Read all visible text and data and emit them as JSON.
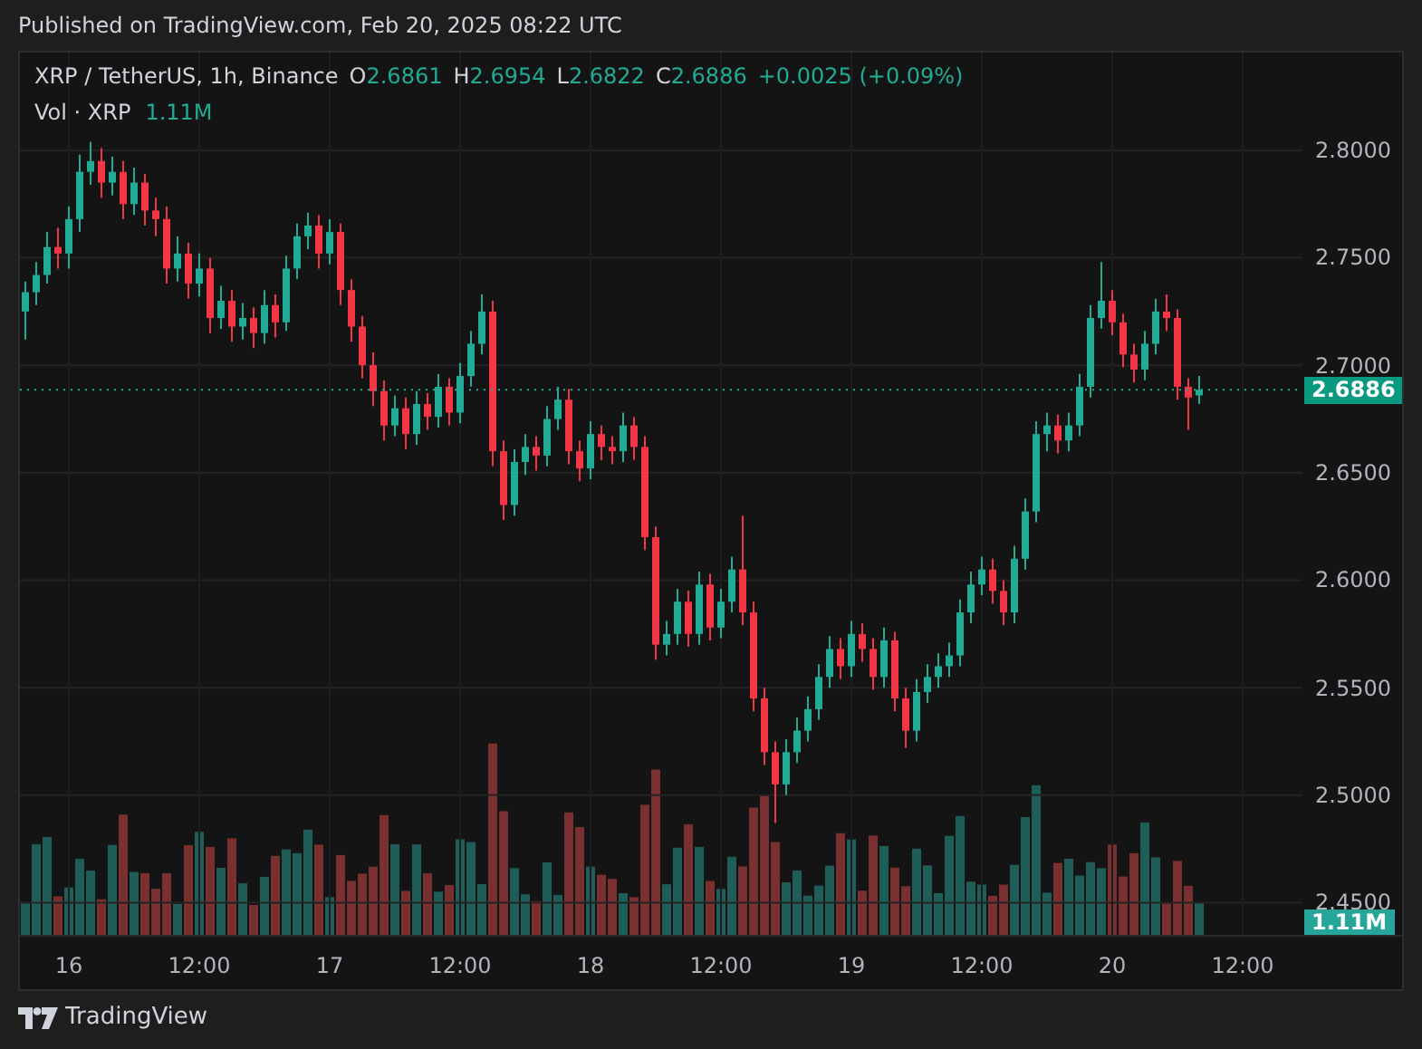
{
  "published": "Published on TradingView.com, Feb 20, 2025 08:22 UTC",
  "legend": {
    "symbol": "XRP / TetherUS, 1h, Binance",
    "ohlc": [
      {
        "label": "O",
        "value": "2.6861"
      },
      {
        "label": "H",
        "value": "2.6954"
      },
      {
        "label": "L",
        "value": "2.6822"
      },
      {
        "label": "C",
        "value": "2.6886"
      }
    ],
    "change": "+0.0025 (+0.09%)",
    "volume_label": "Vol · XRP",
    "volume_value": "1.11M"
  },
  "chart_data": {
    "type": "candlestick",
    "x": [
      "2025-02-15T20:00",
      "2025-02-15T21:00",
      "2025-02-15T22:00",
      "2025-02-15T23:00",
      "2025-02-16T00:00",
      "2025-02-16T01:00",
      "2025-02-16T02:00",
      "2025-02-16T03:00",
      "2025-02-16T04:00",
      "2025-02-16T05:00",
      "2025-02-16T06:00",
      "2025-02-16T07:00",
      "2025-02-16T08:00",
      "2025-02-16T09:00",
      "2025-02-16T10:00",
      "2025-02-16T11:00",
      "2025-02-16T12:00",
      "2025-02-16T13:00",
      "2025-02-16T14:00",
      "2025-02-16T15:00",
      "2025-02-16T16:00",
      "2025-02-16T17:00",
      "2025-02-16T18:00",
      "2025-02-16T19:00",
      "2025-02-16T20:00",
      "2025-02-16T21:00",
      "2025-02-16T22:00",
      "2025-02-16T23:00",
      "2025-02-17T00:00",
      "2025-02-17T01:00",
      "2025-02-17T02:00",
      "2025-02-17T03:00",
      "2025-02-17T04:00",
      "2025-02-17T05:00",
      "2025-02-17T06:00",
      "2025-02-17T07:00",
      "2025-02-17T08:00",
      "2025-02-17T09:00",
      "2025-02-17T10:00",
      "2025-02-17T11:00",
      "2025-02-17T12:00",
      "2025-02-17T13:00",
      "2025-02-17T14:00",
      "2025-02-17T15:00",
      "2025-02-17T16:00",
      "2025-02-17T17:00",
      "2025-02-17T18:00",
      "2025-02-17T19:00",
      "2025-02-17T20:00",
      "2025-02-17T21:00",
      "2025-02-17T22:00",
      "2025-02-17T23:00",
      "2025-02-18T00:00",
      "2025-02-18T01:00",
      "2025-02-18T02:00",
      "2025-02-18T03:00",
      "2025-02-18T04:00",
      "2025-02-18T05:00",
      "2025-02-18T06:00",
      "2025-02-18T07:00",
      "2025-02-18T08:00",
      "2025-02-18T09:00",
      "2025-02-18T10:00",
      "2025-02-18T11:00",
      "2025-02-18T12:00",
      "2025-02-18T13:00",
      "2025-02-18T14:00",
      "2025-02-18T15:00",
      "2025-02-18T16:00",
      "2025-02-18T17:00",
      "2025-02-18T18:00",
      "2025-02-18T19:00",
      "2025-02-18T20:00",
      "2025-02-18T21:00",
      "2025-02-18T22:00",
      "2025-02-18T23:00",
      "2025-02-19T00:00",
      "2025-02-19T01:00",
      "2025-02-19T02:00",
      "2025-02-19T03:00",
      "2025-02-19T04:00",
      "2025-02-19T05:00",
      "2025-02-19T06:00",
      "2025-02-19T07:00",
      "2025-02-19T08:00",
      "2025-02-19T09:00",
      "2025-02-19T10:00",
      "2025-02-19T11:00",
      "2025-02-19T12:00",
      "2025-02-19T13:00",
      "2025-02-19T14:00",
      "2025-02-19T15:00",
      "2025-02-19T16:00",
      "2025-02-19T17:00",
      "2025-02-19T18:00",
      "2025-02-19T19:00",
      "2025-02-19T20:00",
      "2025-02-19T21:00",
      "2025-02-19T22:00",
      "2025-02-19T23:00",
      "2025-02-20T00:00",
      "2025-02-20T01:00",
      "2025-02-20T02:00",
      "2025-02-20T03:00",
      "2025-02-20T04:00",
      "2025-02-20T05:00",
      "2025-02-20T06:00",
      "2025-02-20T07:00",
      "2025-02-20T08:00"
    ],
    "ohlc": [
      [
        2.725,
        2.739,
        2.712,
        2.734
      ],
      [
        2.734,
        2.748,
        2.728,
        2.742
      ],
      [
        2.742,
        2.762,
        2.738,
        2.755
      ],
      [
        2.755,
        2.764,
        2.745,
        2.752
      ],
      [
        2.752,
        2.774,
        2.745,
        2.768
      ],
      [
        2.768,
        2.798,
        2.762,
        2.79
      ],
      [
        2.79,
        2.804,
        2.784,
        2.795
      ],
      [
        2.795,
        2.801,
        2.778,
        2.785
      ],
      [
        2.785,
        2.797,
        2.779,
        2.79
      ],
      [
        2.79,
        2.795,
        2.768,
        2.775
      ],
      [
        2.775,
        2.792,
        2.77,
        2.785
      ],
      [
        2.785,
        2.789,
        2.765,
        2.772
      ],
      [
        2.772,
        2.778,
        2.76,
        2.768
      ],
      [
        2.768,
        2.774,
        2.738,
        2.745
      ],
      [
        2.745,
        2.76,
        2.739,
        2.752
      ],
      [
        2.752,
        2.757,
        2.731,
        2.738
      ],
      [
        2.738,
        2.752,
        2.732,
        2.745
      ],
      [
        2.745,
        2.75,
        2.715,
        2.722
      ],
      [
        2.722,
        2.737,
        2.717,
        2.73
      ],
      [
        2.73,
        2.735,
        2.711,
        2.718
      ],
      [
        2.718,
        2.729,
        2.712,
        2.722
      ],
      [
        2.722,
        2.727,
        2.708,
        2.715
      ],
      [
        2.715,
        2.735,
        2.71,
        2.728
      ],
      [
        2.728,
        2.733,
        2.713,
        2.72
      ],
      [
        2.72,
        2.751,
        2.716,
        2.745
      ],
      [
        2.745,
        2.766,
        2.74,
        2.76
      ],
      [
        2.76,
        2.771,
        2.754,
        2.765
      ],
      [
        2.765,
        2.77,
        2.745,
        2.752
      ],
      [
        2.752,
        2.768,
        2.747,
        2.762
      ],
      [
        2.762,
        2.766,
        2.728,
        2.735
      ],
      [
        2.735,
        2.74,
        2.711,
        2.718
      ],
      [
        2.718,
        2.723,
        2.694,
        2.7
      ],
      [
        2.7,
        2.706,
        2.681,
        2.688
      ],
      [
        2.688,
        2.693,
        2.665,
        2.672
      ],
      [
        2.672,
        2.686,
        2.667,
        2.68
      ],
      [
        2.68,
        2.685,
        2.661,
        2.668
      ],
      [
        2.668,
        2.688,
        2.663,
        2.682
      ],
      [
        2.682,
        2.687,
        2.67,
        2.676
      ],
      [
        2.676,
        2.696,
        2.671,
        2.69
      ],
      [
        2.69,
        2.694,
        2.672,
        2.678
      ],
      [
        2.678,
        2.701,
        2.673,
        2.695
      ],
      [
        2.695,
        2.716,
        2.69,
        2.71
      ],
      [
        2.71,
        2.733,
        2.705,
        2.725
      ],
      [
        2.725,
        2.73,
        2.653,
        2.66
      ],
      [
        2.66,
        2.665,
        2.628,
        2.635
      ],
      [
        2.635,
        2.661,
        2.63,
        2.655
      ],
      [
        2.655,
        2.668,
        2.649,
        2.662
      ],
      [
        2.662,
        2.667,
        2.651,
        2.658
      ],
      [
        2.658,
        2.681,
        2.653,
        2.675
      ],
      [
        2.675,
        2.69,
        2.67,
        2.684
      ],
      [
        2.684,
        2.689,
        2.654,
        2.66
      ],
      [
        2.66,
        2.665,
        2.646,
        2.652
      ],
      [
        2.652,
        2.674,
        2.647,
        2.668
      ],
      [
        2.668,
        2.672,
        2.656,
        2.662
      ],
      [
        2.662,
        2.667,
        2.654,
        2.66
      ],
      [
        2.66,
        2.678,
        2.655,
        2.672
      ],
      [
        2.672,
        2.676,
        2.656,
        2.662
      ],
      [
        2.662,
        2.667,
        2.614,
        2.62
      ],
      [
        2.62,
        2.625,
        2.563,
        2.57
      ],
      [
        2.57,
        2.581,
        2.565,
        2.575
      ],
      [
        2.575,
        2.596,
        2.57,
        2.59
      ],
      [
        2.59,
        2.595,
        2.569,
        2.575
      ],
      [
        2.575,
        2.604,
        2.57,
        2.598
      ],
      [
        2.598,
        2.603,
        2.572,
        2.578
      ],
      [
        2.578,
        2.596,
        2.573,
        2.59
      ],
      [
        2.59,
        2.611,
        2.585,
        2.605
      ],
      [
        2.605,
        2.63,
        2.579,
        2.585
      ],
      [
        2.585,
        2.59,
        2.539,
        2.545
      ],
      [
        2.545,
        2.55,
        2.514,
        2.52
      ],
      [
        2.52,
        2.525,
        2.487,
        2.505
      ],
      [
        2.505,
        2.526,
        2.5,
        2.52
      ],
      [
        2.52,
        2.536,
        2.515,
        2.53
      ],
      [
        2.53,
        2.546,
        2.525,
        2.54
      ],
      [
        2.54,
        2.561,
        2.535,
        2.555
      ],
      [
        2.555,
        2.574,
        2.55,
        2.568
      ],
      [
        2.568,
        2.573,
        2.554,
        2.56
      ],
      [
        2.56,
        2.581,
        2.555,
        2.575
      ],
      [
        2.575,
        2.58,
        2.562,
        2.568
      ],
      [
        2.568,
        2.573,
        2.549,
        2.555
      ],
      [
        2.555,
        2.578,
        2.55,
        2.572
      ],
      [
        2.572,
        2.576,
        2.539,
        2.545
      ],
      [
        2.545,
        2.55,
        2.522,
        2.53
      ],
      [
        2.53,
        2.554,
        2.525,
        2.548
      ],
      [
        2.548,
        2.561,
        2.543,
        2.555
      ],
      [
        2.555,
        2.566,
        2.55,
        2.56
      ],
      [
        2.56,
        2.571,
        2.555,
        2.565
      ],
      [
        2.565,
        2.591,
        2.56,
        2.585
      ],
      [
        2.585,
        2.604,
        2.58,
        2.598
      ],
      [
        2.598,
        2.611,
        2.593,
        2.605
      ],
      [
        2.605,
        2.61,
        2.589,
        2.595
      ],
      [
        2.595,
        2.6,
        2.579,
        2.585
      ],
      [
        2.585,
        2.616,
        2.58,
        2.61
      ],
      [
        2.61,
        2.638,
        2.605,
        2.632
      ],
      [
        2.632,
        2.674,
        2.627,
        2.668
      ],
      [
        2.668,
        2.678,
        2.66,
        2.672
      ],
      [
        2.672,
        2.677,
        2.659,
        2.665
      ],
      [
        2.665,
        2.678,
        2.66,
        2.672
      ],
      [
        2.672,
        2.696,
        2.667,
        2.69
      ],
      [
        2.69,
        2.728,
        2.685,
        2.722
      ],
      [
        2.722,
        2.748,
        2.717,
        2.73
      ],
      [
        2.73,
        2.735,
        2.714,
        2.72
      ],
      [
        2.72,
        2.724,
        2.699,
        2.705
      ],
      [
        2.705,
        2.71,
        2.692,
        2.698
      ],
      [
        2.698,
        2.716,
        2.693,
        2.71
      ],
      [
        2.71,
        2.731,
        2.705,
        2.725
      ],
      [
        2.725,
        2.733,
        2.716,
        2.722
      ],
      [
        2.722,
        2.726,
        2.684,
        2.69
      ],
      [
        2.69,
        2.694,
        2.67,
        2.685
      ],
      [
        2.686,
        2.695,
        2.682,
        2.6886
      ]
    ],
    "xlim": [
      "2025-02-15T19:30",
      "2025-02-21T03:00"
    ],
    "grid": true,
    "ref_lines": [
      {
        "axis": "y",
        "value": 2.6886
      }
    ],
    "ylim": [
      2.435,
      2.8455
    ],
    "xticks": [
      {
        "value": "2025-02-16T00:00",
        "label": "16"
      },
      {
        "value": "2025-02-16T12:00",
        "label": "12:00"
      },
      {
        "value": "2025-02-17T00:00",
        "label": "17"
      },
      {
        "value": "2025-02-17T12:00",
        "label": "12:00"
      },
      {
        "value": "2025-02-18T00:00",
        "label": "18"
      },
      {
        "value": "2025-02-18T12:00",
        "label": "12:00"
      },
      {
        "value": "2025-02-19T00:00",
        "label": "19"
      },
      {
        "value": "2025-02-19T12:00",
        "label": "12:00"
      },
      {
        "value": "2025-02-20T00:00",
        "label": "20"
      },
      {
        "value": "2025-02-20T12:00",
        "label": "12:00"
      }
    ],
    "yticks": [
      {
        "value": 2.8,
        "label": "2.8000"
      },
      {
        "value": 2.75,
        "label": "2.7500"
      },
      {
        "value": 2.7,
        "label": "2.7000"
      },
      {
        "value": 2.65,
        "label": "2.6500"
      },
      {
        "value": 2.6,
        "label": "2.6000"
      },
      {
        "value": 2.55,
        "label": "2.5500"
      },
      {
        "value": 2.5,
        "label": "2.5000"
      },
      {
        "value": 2.45,
        "label": "2.4500"
      }
    ]
  },
  "last_price": "2.6886",
  "volume_tag": "1.11M",
  "brand": "TradingView"
}
